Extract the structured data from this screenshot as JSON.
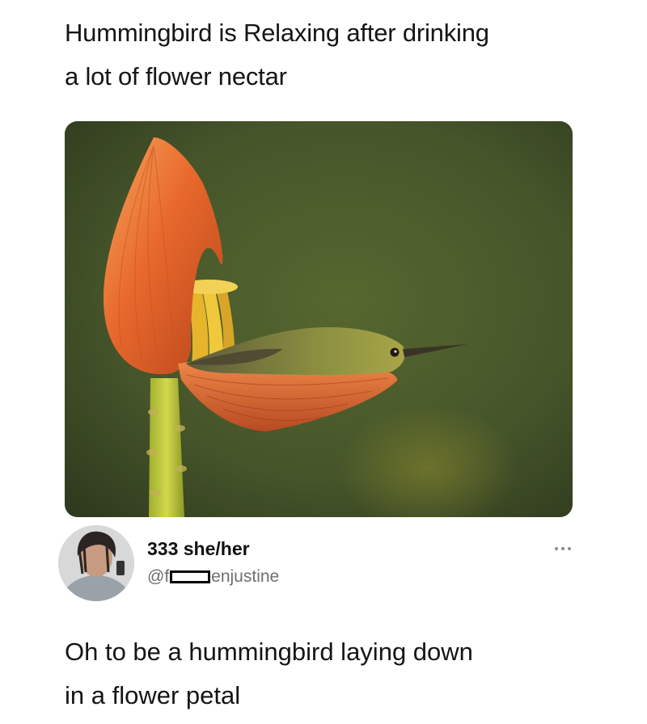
{
  "post": {
    "caption": "Hummingbird is Relaxing after drinking\na lot of flower nectar"
  },
  "photo": {
    "subject": "hummingbird resting in a flower petal",
    "background_color": "#4b5a2c"
  },
  "tweet": {
    "display_name": "333 she/her",
    "handle_prefix": "@f",
    "handle_suffix": "enjustine",
    "text": "Oh to be a hummingbird laying down\nin a flower petal",
    "more_icon": "ellipsis-icon"
  },
  "colors": {
    "text": "#151515",
    "handle": "#6f6f6f",
    "petal": "#e8622a",
    "stamen": "#e8c23a"
  }
}
